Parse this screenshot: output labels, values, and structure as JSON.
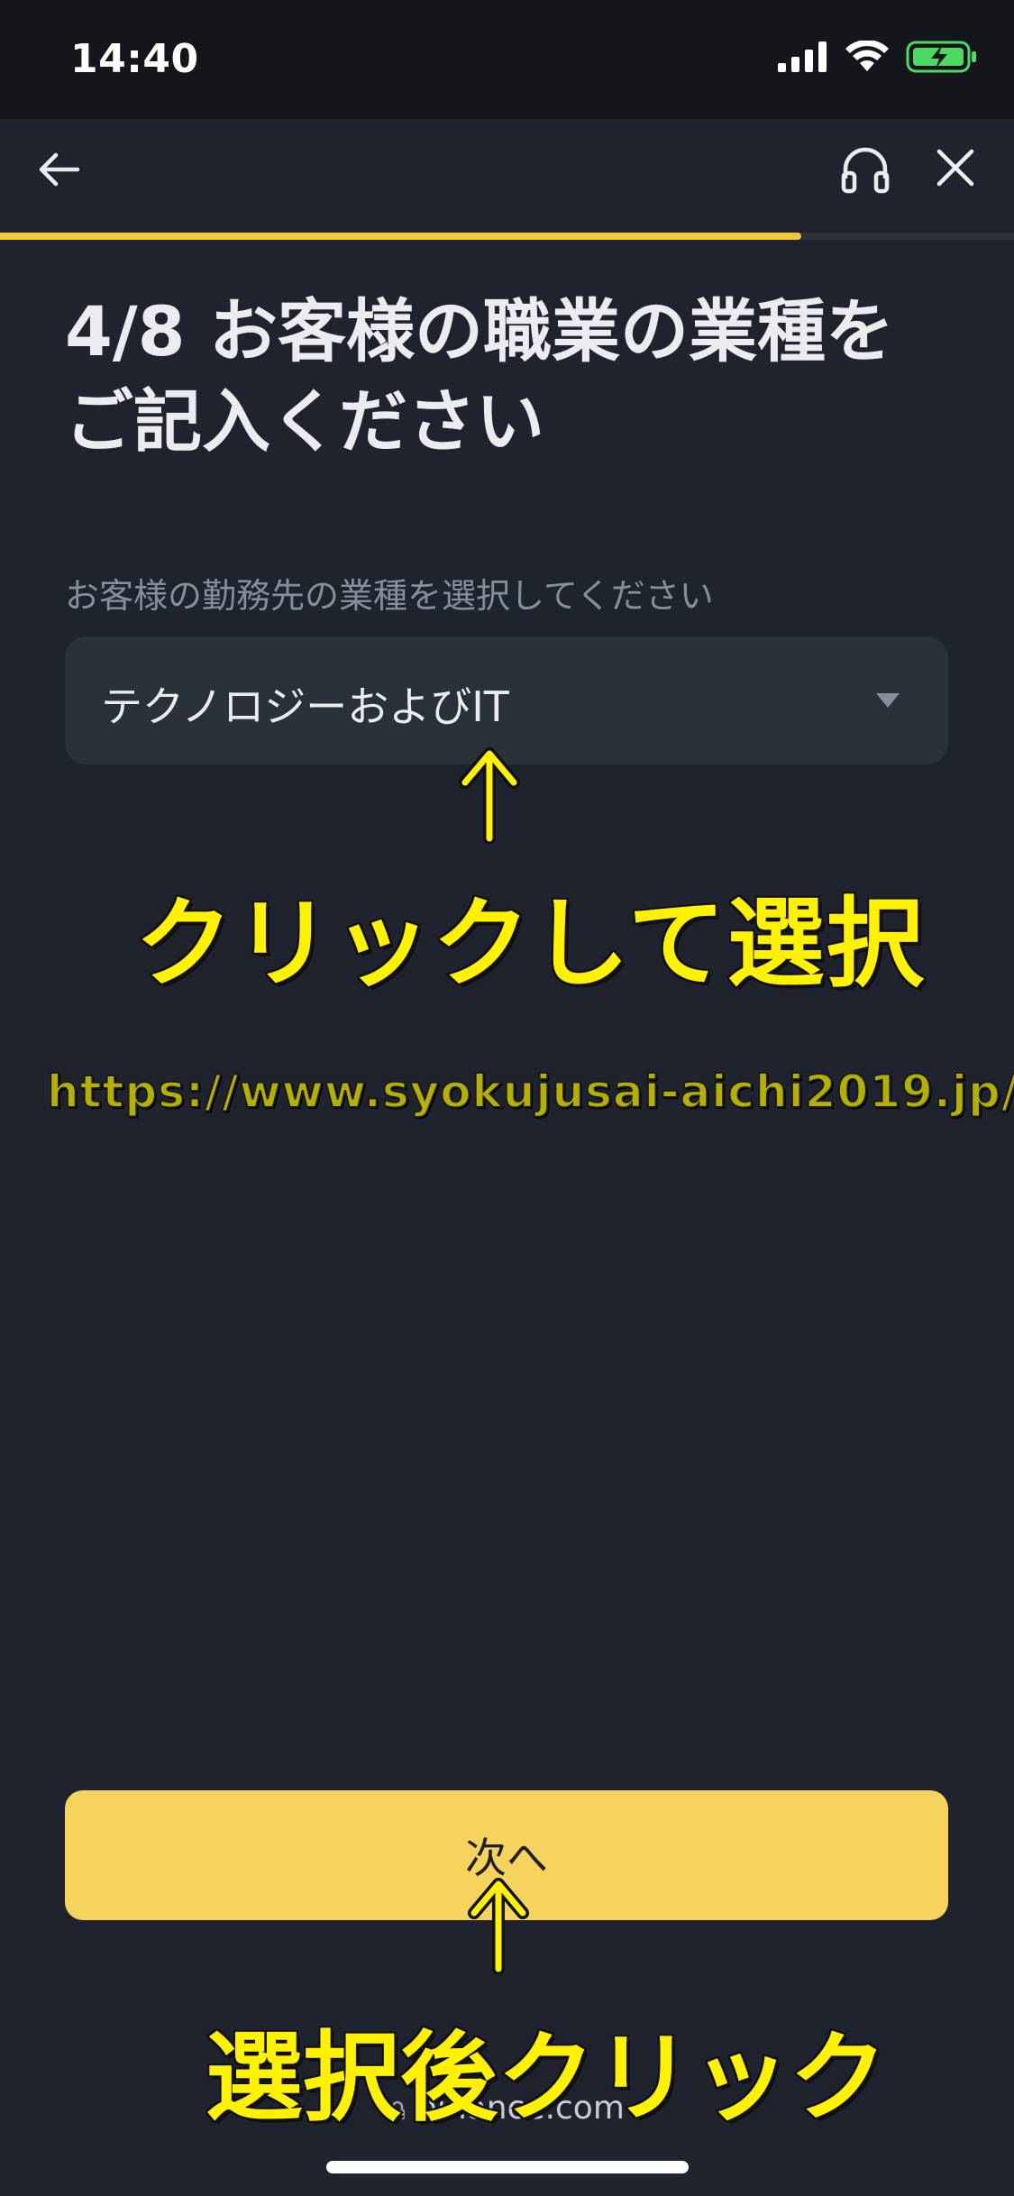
{
  "status_bar": {
    "time": "14:40"
  },
  "progress": {
    "fraction": 0.79,
    "color": "#f0c63a"
  },
  "page": {
    "title": "4/8 お客様の職業の業種をご記入ください",
    "field_label": "お客様の勤務先の業種を選択してください",
    "selected_value": "テクノロジーおよびIT",
    "next_label": "次へ",
    "domain": "binance.com"
  },
  "annotations": {
    "click_select": "クリックして選択",
    "url": "https://www.syokujusai-aichi2019.jp/",
    "after_select": "選択後クリック",
    "color": "#fff200"
  },
  "icons": {
    "back": "arrow-left-icon",
    "support": "headset-icon",
    "close": "close-icon",
    "dropdown": "caret-down-icon",
    "lock": "lock-icon"
  }
}
